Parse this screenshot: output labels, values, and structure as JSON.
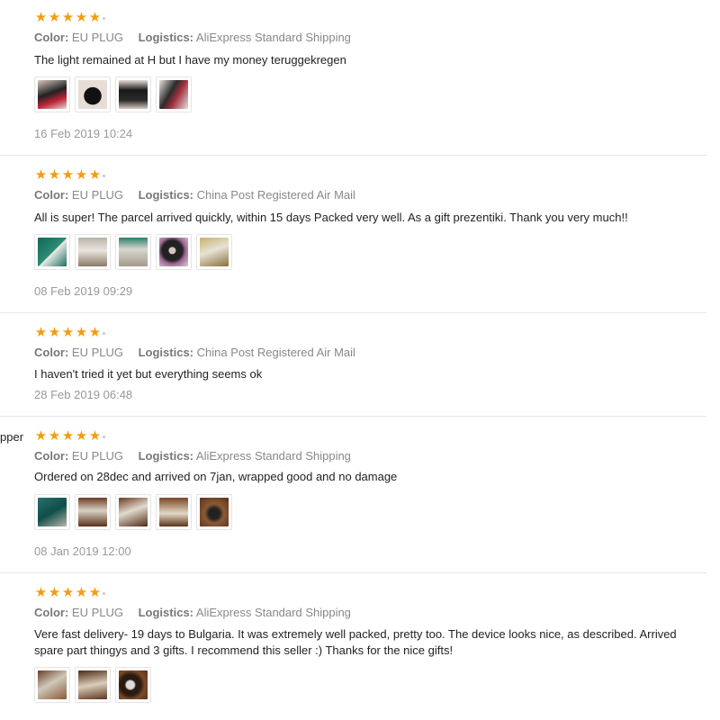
{
  "reviews": [
    {
      "name_fragment": "",
      "color_label": "Color:",
      "color_value": "EU PLUG",
      "logistics_label": "Logistics:",
      "logistics_value": "AliExpress Standard Shipping",
      "text": "The light remained at H but I have my money teruggekregen",
      "date": "16 Feb 2019 10:24",
      "photos": [
        "photo-1",
        "photo-2",
        "photo-3",
        "photo-4"
      ]
    },
    {
      "name_fragment": "",
      "color_label": "Color:",
      "color_value": "EU PLUG",
      "logistics_label": "Logistics:",
      "logistics_value": "China Post Registered Air Mail",
      "text": "All is super! The parcel arrived quickly, within 15 days Packed very well. As a gift prezentiki. Thank you very much!!",
      "date": "08 Feb 2019 09:29",
      "photos": [
        "photo-1",
        "photo-2",
        "photo-3",
        "photo-4",
        "photo-5"
      ]
    },
    {
      "name_fragment": "",
      "color_label": "Color:",
      "color_value": "EU PLUG",
      "logistics_label": "Logistics:",
      "logistics_value": "China Post Registered Air Mail",
      "text": "I haven't tried it yet but everything seems ok",
      "date": "28 Feb 2019 06:48",
      "photos": []
    },
    {
      "name_fragment": "pper",
      "color_label": "Color:",
      "color_value": "EU PLUG",
      "logistics_label": "Logistics:",
      "logistics_value": "AliExpress Standard Shipping",
      "text": "Ordered on 28dec and arrived on 7jan, wrapped good and no damage",
      "date": "08 Jan 2019 12:00",
      "photos": [
        "photo-1",
        "photo-2",
        "photo-3",
        "photo-4",
        "photo-5"
      ]
    },
    {
      "name_fragment": "",
      "color_label": "Color:",
      "color_value": "EU PLUG",
      "logistics_label": "Logistics:",
      "logistics_value": "AliExpress Standard Shipping",
      "text": "Vere fast delivery- 19 days to Bulgaria. It was extremely well packed, pretty too. The device looks nice, as described. Arrived",
      "text_line2": "spare part thingys and 3 gifts. I recommend this seller :) Thanks for the nice gifts!",
      "date": "",
      "photos": [
        "photo-1",
        "photo-2",
        "photo-3"
      ]
    }
  ],
  "star_glyph": "★",
  "colors": {
    "star": "#f39c12",
    "divider": "#e8e8e8"
  }
}
